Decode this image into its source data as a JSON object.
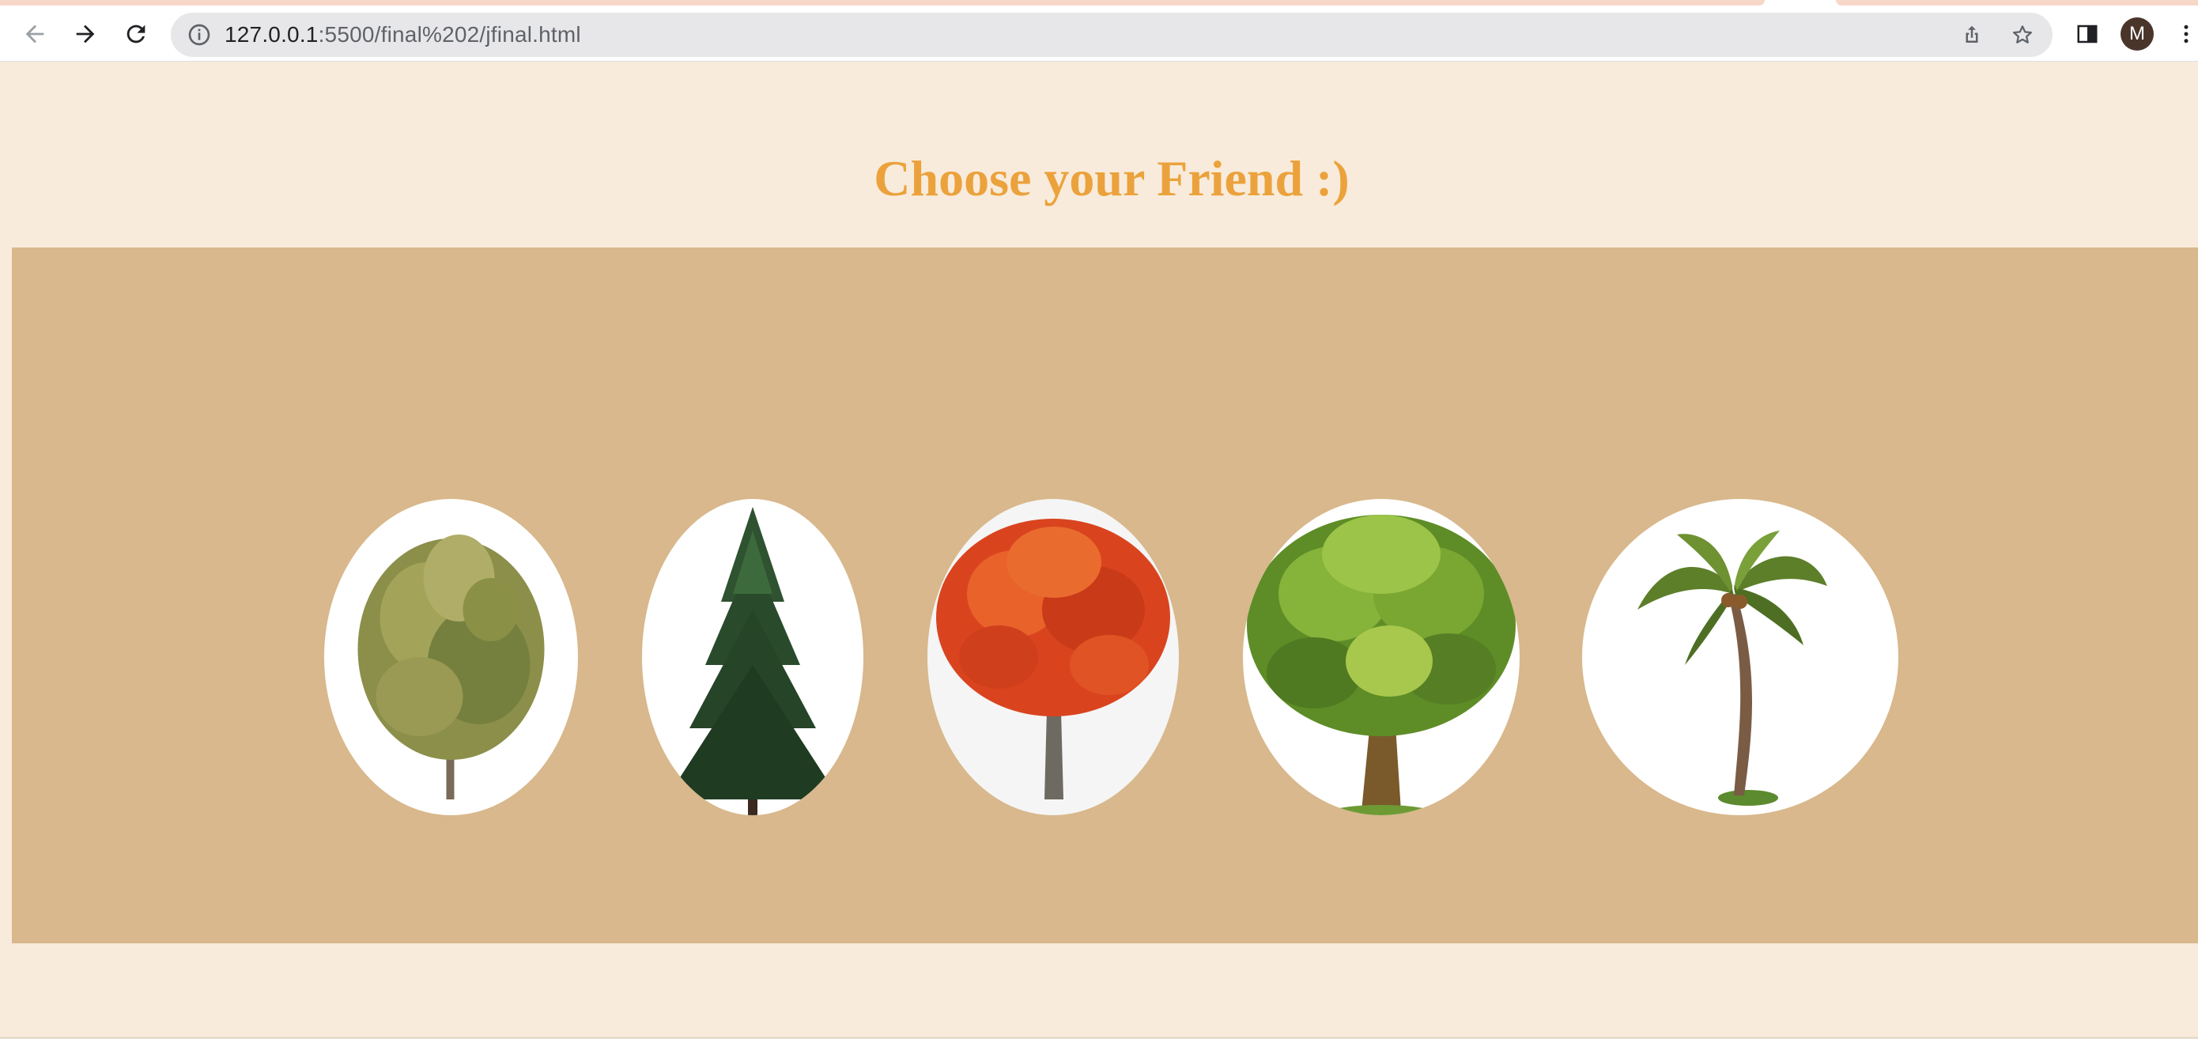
{
  "browser": {
    "url_host": "127.0.0.1",
    "url_rest": ":5500/final%202/jfinal.html",
    "profile_initial": "M",
    "icons": {
      "back": "arrow-left-icon",
      "forward": "arrow-right-icon",
      "reload": "reload-icon",
      "site_info": "info-icon",
      "share": "share-icon",
      "bookmark": "star-icon",
      "side_panel": "side-panel-icon",
      "menu": "kebab-menu-icon"
    }
  },
  "page": {
    "title": "Choose your Friend :)",
    "title_color": "#eba23c",
    "band_color": "#d8b88c",
    "background_color": "#f8ebdb",
    "friends": [
      {
        "icon": "deciduous-tree-icon"
      },
      {
        "icon": "fir-tree-icon"
      },
      {
        "icon": "autumn-tree-icon"
      },
      {
        "icon": "green-tree-icon"
      },
      {
        "icon": "palm-tree-icon"
      }
    ]
  }
}
